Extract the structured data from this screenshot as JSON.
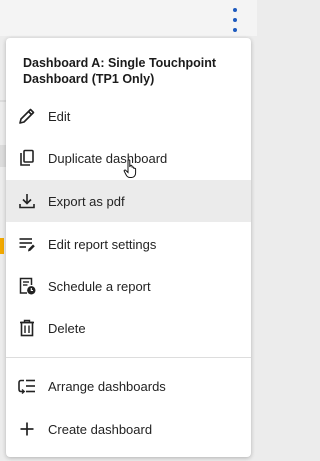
{
  "menu": {
    "title": "Dashboard A: Single Touchpoint Dashboard (TP1 Only)",
    "items": [
      {
        "label": "Edit",
        "icon": "pencil-icon"
      },
      {
        "label": "Duplicate dashboard",
        "icon": "copy-icon"
      },
      {
        "label": "Export as pdf",
        "icon": "download-icon",
        "state": "hovered"
      },
      {
        "label": "Edit report settings",
        "icon": "report-settings-icon"
      },
      {
        "label": "Schedule a report",
        "icon": "schedule-report-icon"
      },
      {
        "label": "Delete",
        "icon": "trash-icon"
      }
    ],
    "secondary_items": [
      {
        "label": "Arrange dashboards",
        "icon": "arrange-icon"
      },
      {
        "label": "Create dashboard",
        "icon": "plus-icon"
      }
    ]
  },
  "colors": {
    "kebab": "#1e5bbf",
    "hover_bg": "#ebebeb",
    "accent": "#f2a900"
  }
}
